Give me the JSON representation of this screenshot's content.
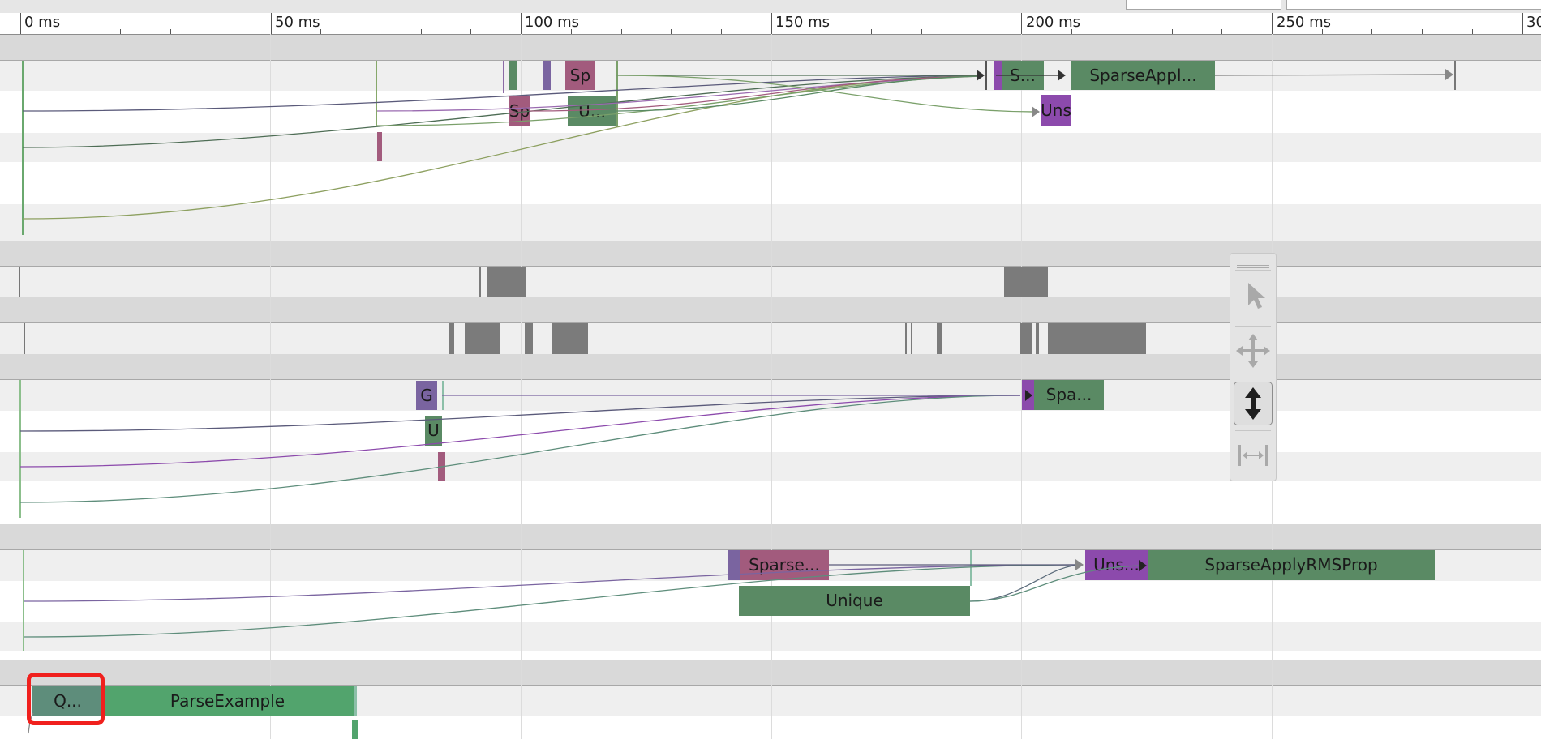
{
  "window": {
    "title": ""
  },
  "ruler": {
    "labels": [
      "0 ms",
      "50 ms",
      "100 ms",
      "150 ms",
      "200 ms",
      "250 ms",
      "30"
    ]
  },
  "slices": {
    "sp_top": "Sp",
    "sp_mid": "Sp",
    "u_dots_top": "U...",
    "s_dots": "S...",
    "sparse_appl": "SparseAppl...",
    "uns_top": "Uns",
    "g_label": "G",
    "u_label": "U",
    "spa_dots": "Spa...",
    "sparse_dots": "Sparse...",
    "unique": "Unique",
    "uns_dots": "Uns...",
    "sparse_apply_rmsprop": "SparseApplyRMSProp",
    "q_dots": "Q...",
    "parse_example": "ParseExample"
  },
  "toolbar": {
    "tools": [
      "selection-tool",
      "pan-tool",
      "zoom-tool",
      "timing-tool"
    ],
    "active": "zoom-tool"
  },
  "colors": {
    "green": "#5a8a64",
    "bright_green": "#52a46d",
    "teal": "#5e8d7b",
    "rose": "#a25b7d",
    "violet": "#8c4aac",
    "purple": "#7a64a0",
    "gray": "#7b7b7b",
    "highlight": "#f0201d"
  }
}
